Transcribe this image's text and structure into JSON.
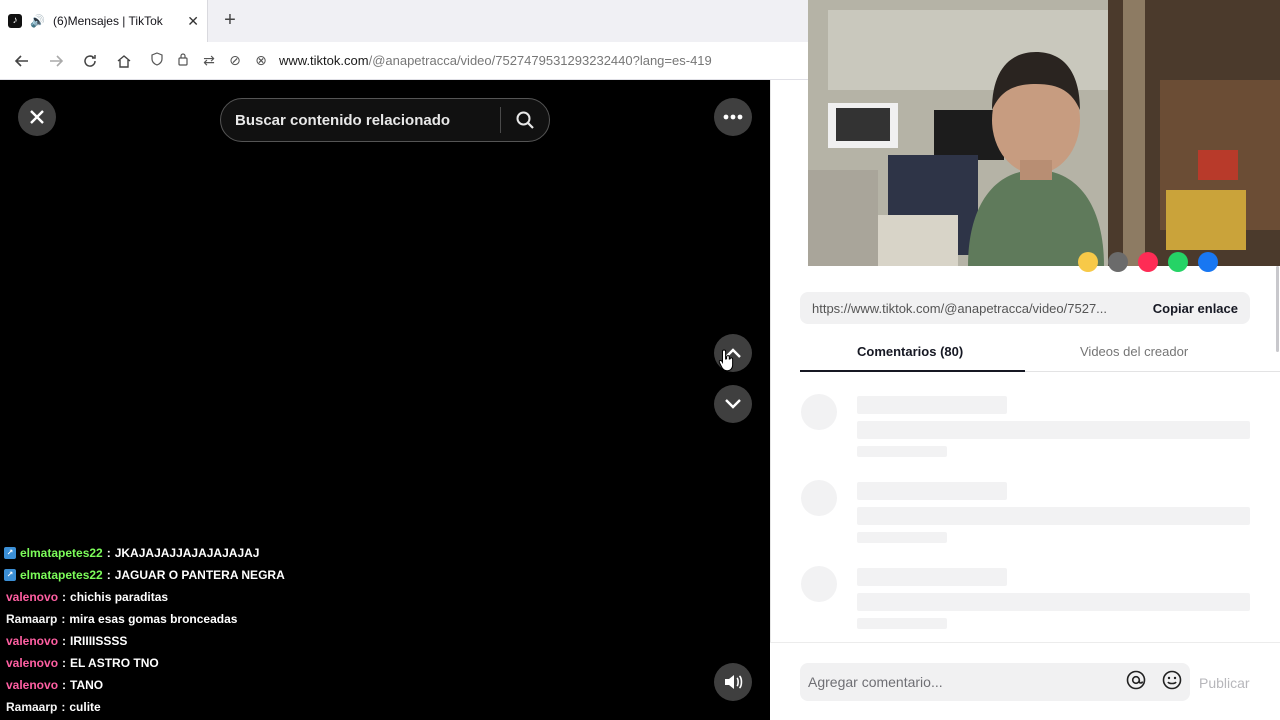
{
  "browser": {
    "tab_title": "(6)Mensajes | TikTok",
    "url_domain": "www.tiktok.com",
    "url_path": "/@anapetracca/video/7527479531293232440?lang=es-419"
  },
  "video": {
    "search_placeholder": "Buscar contenido relacionado"
  },
  "chat": [
    {
      "user": "elmatapetes22",
      "msg": "JKAJAJAJJAJAJAJAJAJ",
      "color": "#7cfc5a",
      "badge": true
    },
    {
      "user": "elmatapetes22",
      "msg": "JAGUAR O PANTERA NEGRA",
      "color": "#7cfc5a",
      "badge": true
    },
    {
      "user": "valenovo",
      "msg": "chichis paraditas",
      "color": "#ff5fa2",
      "badge": false
    },
    {
      "user": "Ramaarp",
      "msg": "mira esas gomas bronceadas",
      "color": "#f5f5f5",
      "badge": false
    },
    {
      "user": "valenovo",
      "msg": "IRIIIISSSS",
      "color": "#ff5fa2",
      "badge": false
    },
    {
      "user": "valenovo",
      "msg": "EL ASTRO TNO",
      "color": "#ff5fa2",
      "badge": false
    },
    {
      "user": "valenovo",
      "msg": "TANO",
      "color": "#ff5fa2",
      "badge": false
    },
    {
      "user": "Ramaarp",
      "msg": "culite",
      "color": "#f5f5f5",
      "badge": false
    }
  ],
  "right": {
    "share_link": "https://www.tiktok.com/@anapetracca/video/7527...",
    "copy_label": "Copiar enlace",
    "tab_comments": "Comentarios (80)",
    "tab_videos": "Videos del creador",
    "comment_placeholder": "Agregar comentario...",
    "publish_label": "Publicar"
  },
  "colors": {
    "share_dots": [
      "#f7c948",
      "#6b6b6b",
      "#fe2c55",
      "#25d366",
      "#1877f2"
    ]
  }
}
